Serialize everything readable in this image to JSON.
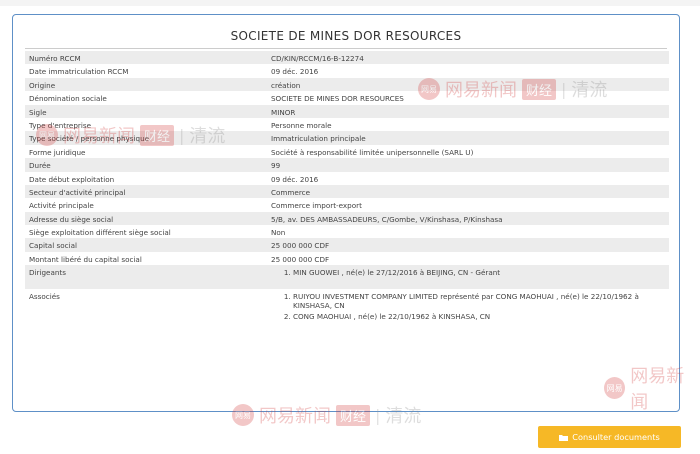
{
  "title": "SOCIETE DE MINES DOR RESOURCES",
  "rows": [
    {
      "label": "Numéro RCCM",
      "value": "CD/KIN/RCCM/16-B-12274"
    },
    {
      "label": "Date immatriculation RCCM",
      "value": "09 déc. 2016"
    },
    {
      "label": "Origine",
      "value": "création"
    },
    {
      "label": "Dénomination sociale",
      "value": "SOCIETE DE MINES DOR RESOURCES"
    },
    {
      "label": "Sigle",
      "value": "MINOR"
    },
    {
      "label": "Type d'entreprise",
      "value": "Personne morale"
    },
    {
      "label": "Type société / personne physique",
      "value": "Immatriculation principale"
    },
    {
      "label": "Forme juridique",
      "value": "Société à responsabilité limitée unipersonnelle (SARL U)"
    },
    {
      "label": "Durée",
      "value": "99"
    },
    {
      "label": "Date début exploitation",
      "value": "09 déc. 2016"
    },
    {
      "label": "Secteur d'activité principal",
      "value": "Commerce"
    },
    {
      "label": "Activité principale",
      "value": "Commerce import-export"
    },
    {
      "label": "Adresse du siège social",
      "value": "5/B, av. DES AMBASSADEURS, C/Gombe, V/Kinshasa, P/Kinshasa"
    },
    {
      "label": "Siège exploitation différent siège social",
      "value": "Non"
    },
    {
      "label": "Capital social",
      "value": "25 000 000 CDF"
    },
    {
      "label": "Montant libéré du capital social",
      "value": "25 000 000 CDF"
    }
  ],
  "dirigeants": {
    "label": "Dirigeants",
    "items": [
      "MIN GUOWEI , né(e) le 27/12/2016 à BEIJING, CN - Gérant"
    ]
  },
  "associes": {
    "label": "Associés",
    "items": [
      "RUIYOU INVESTMENT COMPANY LIMITED représenté par CONG MAOHUAI , né(e) le 22/10/1962 à KINSHASA, CN",
      "CONG MAOHUAI , né(e) le 22/10/1962 à KINSHASA, CN"
    ]
  },
  "button": {
    "label": "Consulter documents",
    "icon": "folder-icon"
  },
  "watermark": {
    "logo": "网易",
    "brand": "网易新闻",
    "tag": "财经",
    "sep": "|",
    "tail": "清流"
  }
}
